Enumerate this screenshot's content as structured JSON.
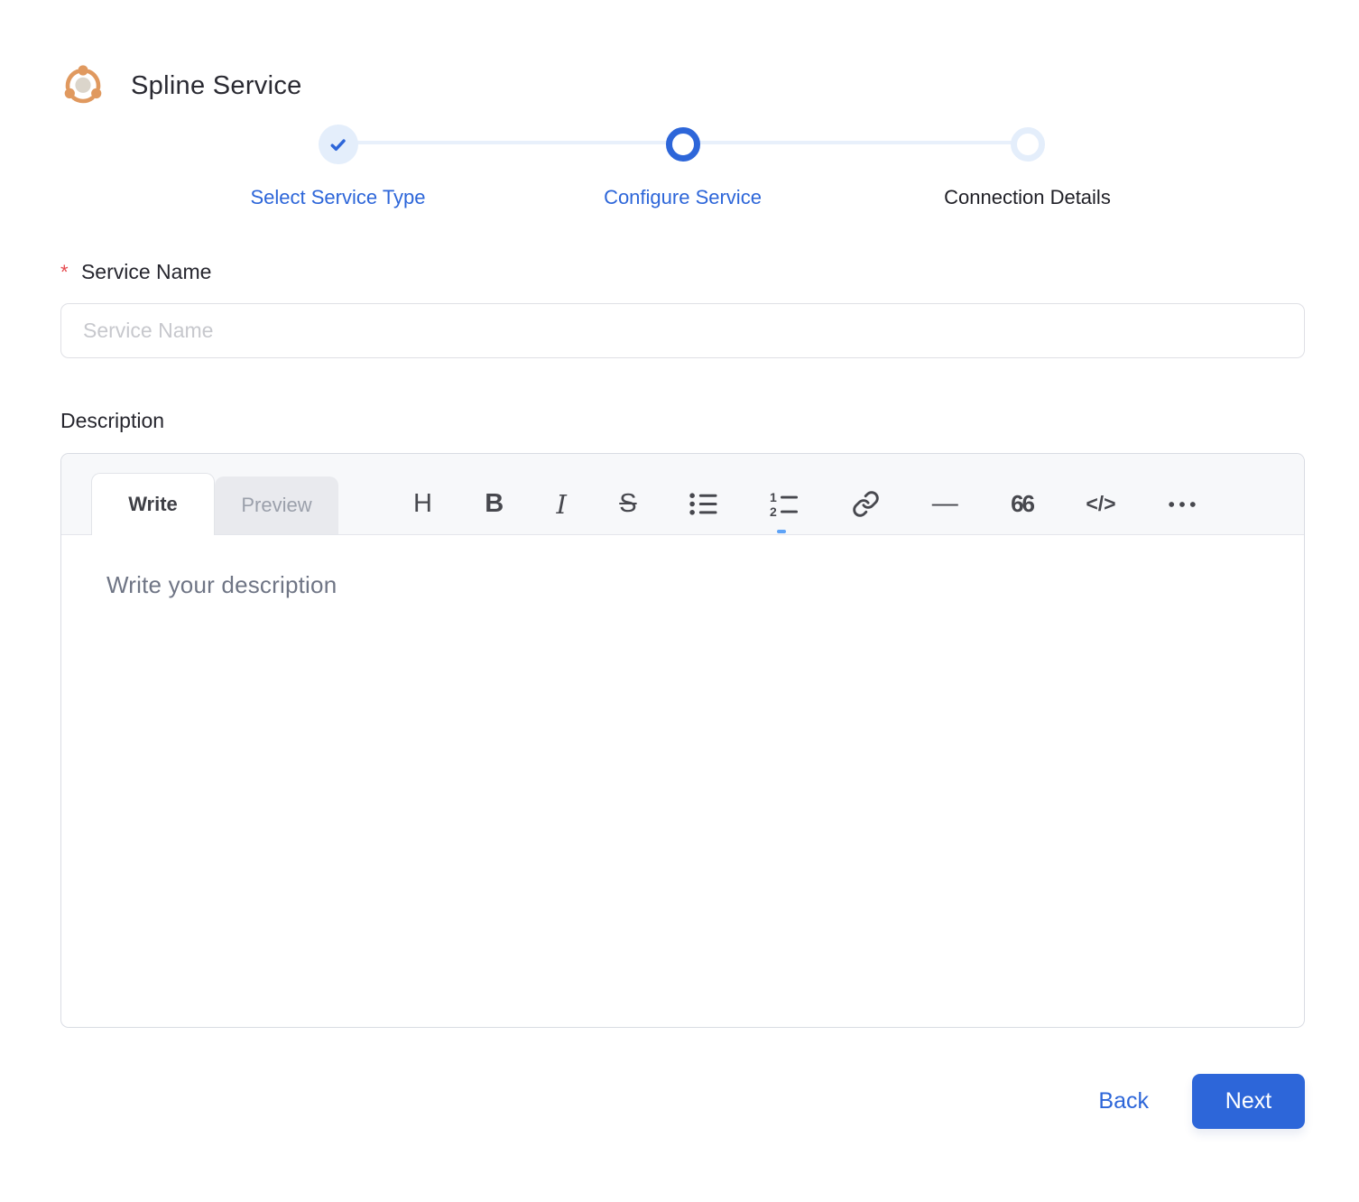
{
  "app": {
    "title": "Spline Service"
  },
  "colors": {
    "accent": "#2D66D9",
    "accent_light": "#E4EEFB",
    "brand_orange": "#E0995F",
    "required_red": "#E5484D"
  },
  "stepper": {
    "steps": [
      {
        "id": "select-service-type",
        "label": "Select Service Type",
        "state": "completed"
      },
      {
        "id": "configure-service",
        "label": "Configure Service",
        "state": "active"
      },
      {
        "id": "connection-details",
        "label": "Connection Details",
        "state": "upcoming"
      }
    ]
  },
  "form": {
    "service_name": {
      "label": "Service Name",
      "required_marker": "*",
      "placeholder": "Service Name",
      "value": ""
    },
    "description": {
      "label": "Description",
      "editor": {
        "tabs": [
          {
            "id": "write",
            "label": "Write",
            "active": true
          },
          {
            "id": "preview",
            "label": "Preview",
            "active": false
          }
        ],
        "toolbar": [
          {
            "name": "heading-icon",
            "glyph": "H"
          },
          {
            "name": "bold-icon",
            "glyph": "B"
          },
          {
            "name": "italic-icon",
            "glyph": "I"
          },
          {
            "name": "strikethrough-icon",
            "glyph": "S"
          },
          {
            "name": "unordered-list-icon",
            "glyph": "svg"
          },
          {
            "name": "ordered-list-icon",
            "glyph": "svg"
          },
          {
            "name": "link-icon",
            "glyph": "svg"
          },
          {
            "name": "horizontal-rule-icon",
            "glyph": "—"
          },
          {
            "name": "quote-icon",
            "glyph": "66"
          },
          {
            "name": "code-icon",
            "glyph": "</>"
          },
          {
            "name": "more-icon",
            "glyph": "svg"
          }
        ],
        "placeholder": "Write your description",
        "value": ""
      }
    }
  },
  "footer": {
    "back_label": "Back",
    "next_label": "Next"
  }
}
